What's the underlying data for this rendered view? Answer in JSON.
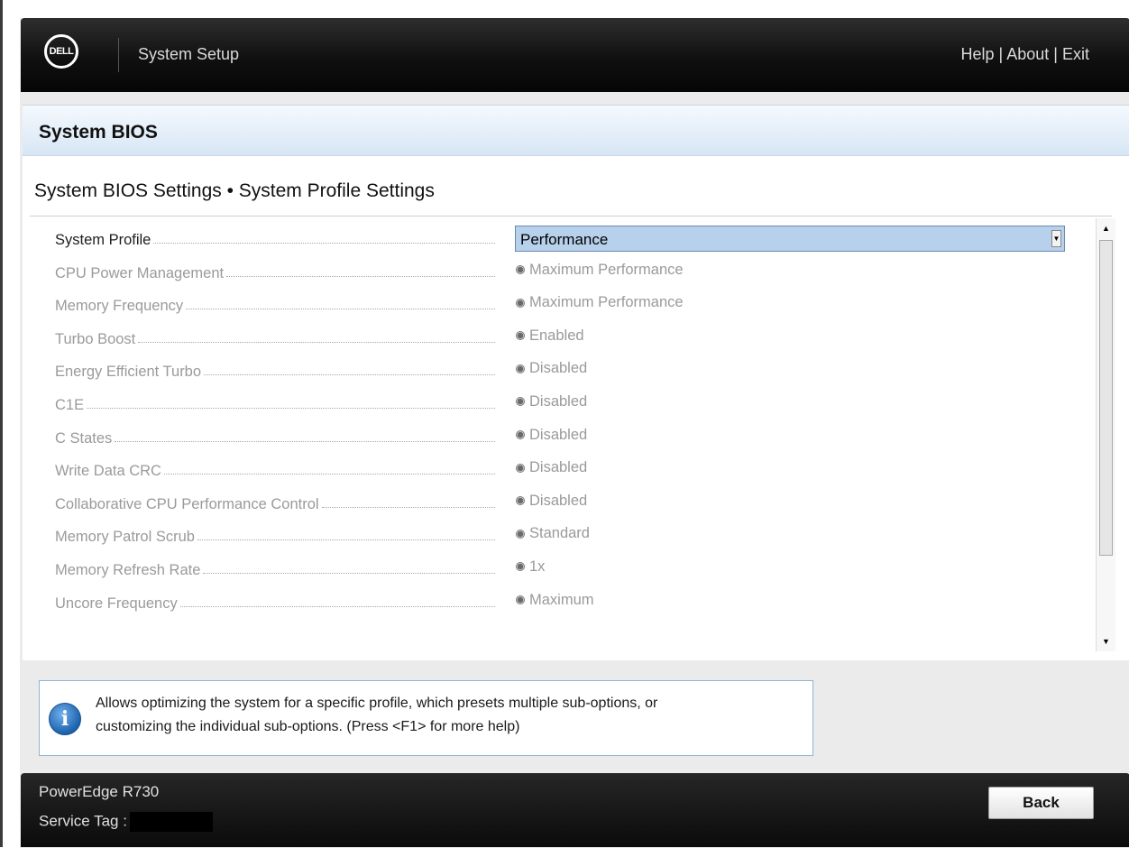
{
  "header": {
    "logo_text": "DELL",
    "title": "System Setup",
    "links": [
      "Help",
      "About",
      "Exit"
    ],
    "separator": "|"
  },
  "panel": {
    "title": "System BIOS",
    "subtitle": "System BIOS Settings • System Profile Settings"
  },
  "settings": [
    {
      "label": "System Profile",
      "value": "Performance",
      "type": "select"
    },
    {
      "label": "CPU Power Management",
      "value": "Maximum Performance",
      "type": "radio"
    },
    {
      "label": "Memory Frequency",
      "value": "Maximum Performance",
      "type": "radio"
    },
    {
      "label": "Turbo Boost",
      "value": "Enabled",
      "type": "radio"
    },
    {
      "label": "Energy Efficient Turbo",
      "value": "Disabled",
      "type": "radio"
    },
    {
      "label": "C1E",
      "value": "Disabled",
      "type": "radio"
    },
    {
      "label": "C States",
      "value": "Disabled",
      "type": "radio"
    },
    {
      "label": "Write Data CRC",
      "value": "Disabled",
      "type": "radio"
    },
    {
      "label": "Collaborative CPU Performance Control",
      "value": "Disabled",
      "type": "radio"
    },
    {
      "label": "Memory Patrol Scrub",
      "value": "Standard",
      "type": "radio"
    },
    {
      "label": "Memory Refresh Rate",
      "value": "1x",
      "type": "radio"
    },
    {
      "label": "Uncore Frequency",
      "value": "Maximum",
      "type": "radio"
    }
  ],
  "help": {
    "icon": "info-icon",
    "line1": "Allows optimizing the system for a specific profile, which presets multiple sub-options, or",
    "line2": "customizing the individual sub-options. (Press <F1> for more help)"
  },
  "footer": {
    "model": "PowerEdge R730",
    "service_tag_label": "Service Tag :",
    "back_label": "Back"
  },
  "colors": {
    "header_bg": "#101010",
    "title_bar": "#d7e6f5",
    "selected_field": "#b7d0ec",
    "disabled_text": "#9a9a9a"
  }
}
